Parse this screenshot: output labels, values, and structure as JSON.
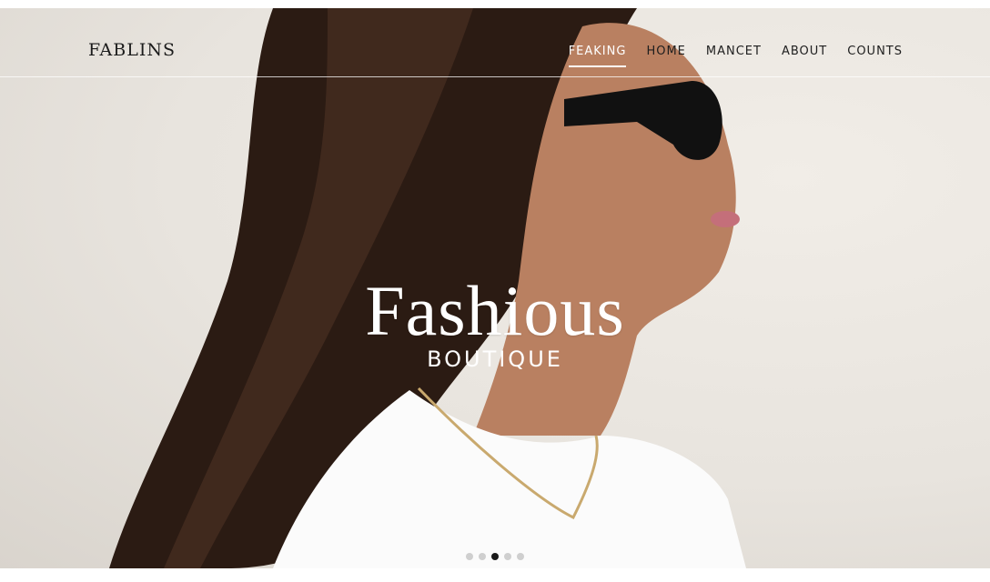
{
  "brand": {
    "logo_text": "FABLINS"
  },
  "nav": {
    "items": [
      {
        "label": "FEAKING"
      },
      {
        "label": "HOME"
      },
      {
        "label": "MANCET"
      },
      {
        "label": "ABOUT"
      },
      {
        "label": "COUNTS"
      }
    ],
    "active_index": 0
  },
  "hero": {
    "title": "Fashious",
    "subtitle": "BOUTIQUE"
  },
  "carousel": {
    "slide_count": 5,
    "active_index": 2
  },
  "colors": {
    "text_dark": "#1b1b1b",
    "text_light": "#ffffff",
    "dot_inactive": "#cfcfcf",
    "dot_active": "#1a1a1a"
  }
}
